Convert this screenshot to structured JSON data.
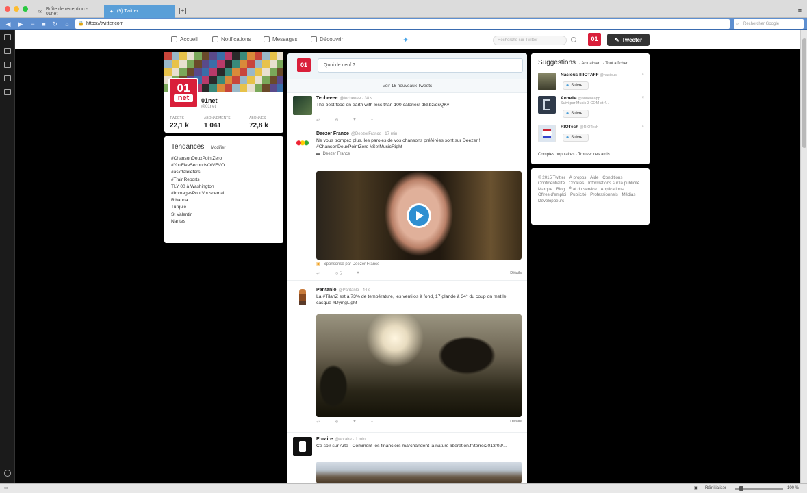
{
  "browser": {
    "tabs": [
      {
        "label": "Boîte de réception - 01net"
      },
      {
        "label": "(9) Twitter"
      }
    ],
    "new_tab": "+",
    "url": "https://twitter.com",
    "search_placeholder": "Rechercher Google"
  },
  "nav": {
    "home": "Accueil",
    "notifications": "Notifications",
    "messages": "Messages",
    "discover": "Découvrir",
    "search_placeholder": "Recherche sur Twitter",
    "avatar": "01",
    "tweet_button": "Tweeter"
  },
  "profile": {
    "name": "01net",
    "handle": "@01net",
    "avatar_line1": "01",
    "avatar_line2": "net",
    "stats": [
      {
        "label": "Tweets",
        "value": "22,1 k"
      },
      {
        "label": "Abonnements",
        "value": "1 041"
      },
      {
        "label": "Abonnés",
        "value": "72,8 k"
      }
    ]
  },
  "trends": {
    "title": "Tendances",
    "modify": "· Modifier",
    "items": [
      "#ChansonDeuxPointZero",
      "#YouFiveSecondsOfVEVO",
      "#askdaleleters",
      "#TrainReports",
      "TLY 00 à Washington",
      "#ImmagesPourVousdemal",
      "Rihanna",
      "Turquie",
      "St Valentin",
      "Nantes"
    ]
  },
  "timeline": {
    "composer_avatar": "01",
    "composer_placeholder": "Quoi de neuf ?",
    "new_tweets": "Voir 16 nouveaux Tweets",
    "tweets": [
      {
        "name": "Techeeee",
        "meta": "@techeeee · 38 s",
        "text": "The best food on earth with less than 100 calories! dld.bz/dsQKv",
        "actions": [
          "↩",
          "⟲",
          "♥",
          "···"
        ],
        "detail": ""
      },
      {
        "name": "Deezer France",
        "meta": "@DeezerFrance · 17 min",
        "text": "Ne vous trompez plus, les paroles de vos chansons préférées sont sur Deezer ! #ChansonDeuxPointZero #SetMusicRight",
        "source": "Deezer France",
        "sponsored": "Sponsorisé par Deezer France",
        "actions": [
          "↩",
          "⟲ 5",
          "♥",
          "···"
        ],
        "detail": "Détails"
      },
      {
        "name": "Pantanlo",
        "meta": "@Pantanlo · 44 s",
        "text": "La #TilanZ est à 73% de température, les ventilos à fond, 17 glande à 34° du coup on met le casque #DyingLight",
        "actions": [
          "↩",
          "⟲",
          "♥",
          "···"
        ],
        "detail": "Détails"
      },
      {
        "name": "Eoraire",
        "meta": "@eoraire · 1 min",
        "text": "Ce soir sur Arte : Comment les financiers marchandent la nature liberation.fr/terre/2013/02/...",
        "actions": [],
        "detail": ""
      }
    ]
  },
  "suggestions": {
    "title": "Suggestions",
    "refresh": "· Actualiser",
    "view_all": "· Tout afficher",
    "follow_label": "Suivre",
    "users": [
      {
        "name": "Nacious IIIIOTAFF",
        "meta": "@nacious"
      },
      {
        "name": "Annelie",
        "meta": "@annelieapp",
        "sub": "Suivi par Music 3 COM et 4..."
      },
      {
        "name": "RIOTech",
        "meta": "@RIOTech"
      }
    ],
    "footer": "Comptes populaires · Trouver des amis"
  },
  "footer_links": [
    "© 2015 Twitter",
    "À propos",
    "Aide",
    "Conditions",
    "Confidentialité",
    "Cookies",
    "Informations sur la publicité",
    "Marque",
    "Blog",
    "État du service",
    "Applications",
    "Offres d'emploi",
    "Publicité",
    "Professionnels",
    "Médias",
    "Développeurs"
  ],
  "statusbar": {
    "zoom_label": "Réinitialiser",
    "zoom_value": "100 %"
  }
}
